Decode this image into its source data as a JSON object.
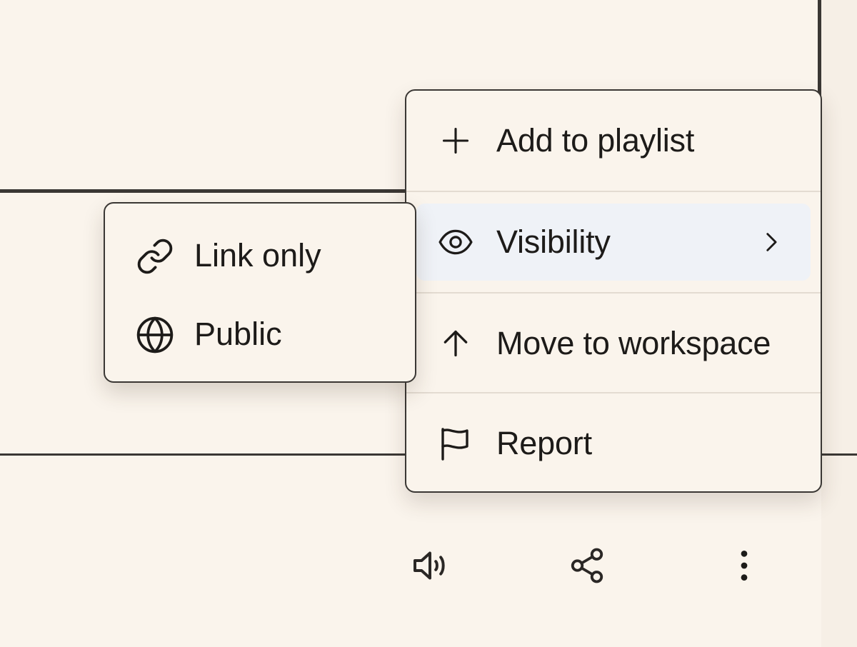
{
  "menu": {
    "items": [
      {
        "label": "Add to playlist",
        "icon": "plus-icon"
      },
      {
        "label": "Visibility",
        "icon": "eye-icon",
        "submenu_indicator": "chevron-right-icon",
        "highlighted": true
      },
      {
        "label": "Move to workspace",
        "icon": "arrow-up-icon"
      },
      {
        "label": "Report",
        "icon": "flag-icon"
      }
    ]
  },
  "submenu": {
    "items": [
      {
        "label": "Link only",
        "icon": "link-icon"
      },
      {
        "label": "Public",
        "icon": "globe-icon"
      }
    ]
  },
  "actions": [
    {
      "icon": "volume-icon"
    },
    {
      "icon": "share-icon"
    },
    {
      "icon": "more-vertical-icon"
    }
  ],
  "colors": {
    "background": "#faf4ec",
    "border": "#3a3734",
    "highlight": "#eff2f7",
    "text": "#1d1b19"
  }
}
